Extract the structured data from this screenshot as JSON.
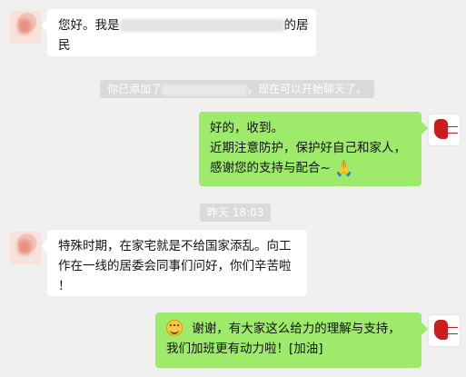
{
  "messages": [
    {
      "id": "m1",
      "side": "left",
      "text_before": "您好。我是",
      "text_after_line1": "的居",
      "text_line2": "民"
    },
    {
      "id": "sys1",
      "type": "system",
      "before": "你已添加了",
      "after": "，现在可以开始聊天了。"
    },
    {
      "id": "m2",
      "side": "right",
      "lines": [
        "好的，收到。",
        "近期注意防护，保护好自己和家人，",
        "感谢您的支持与配合~"
      ],
      "emoji": "pray-icon",
      "emoji_glyph": "🙏"
    },
    {
      "id": "ts1",
      "type": "timestamp",
      "text": "昨天 18:03"
    },
    {
      "id": "m3",
      "side": "left",
      "lines": [
        "特殊时期，在家宅就是不给国家添乱。向工",
        "作在一线的居委会同事们问好，你们辛苦啦",
        "！"
      ]
    },
    {
      "id": "m4",
      "side": "right",
      "line1": "谢谢，有大家这么给力的理解与支持，",
      "line2": "我们加班更有动力啦！[加油]",
      "emoji": "smile-icon"
    }
  ],
  "colors": {
    "background": "#f0f0f0",
    "bubble_self": "#9eea6a",
    "bubble_other": "#ffffff",
    "system_pill": "#dadada"
  }
}
